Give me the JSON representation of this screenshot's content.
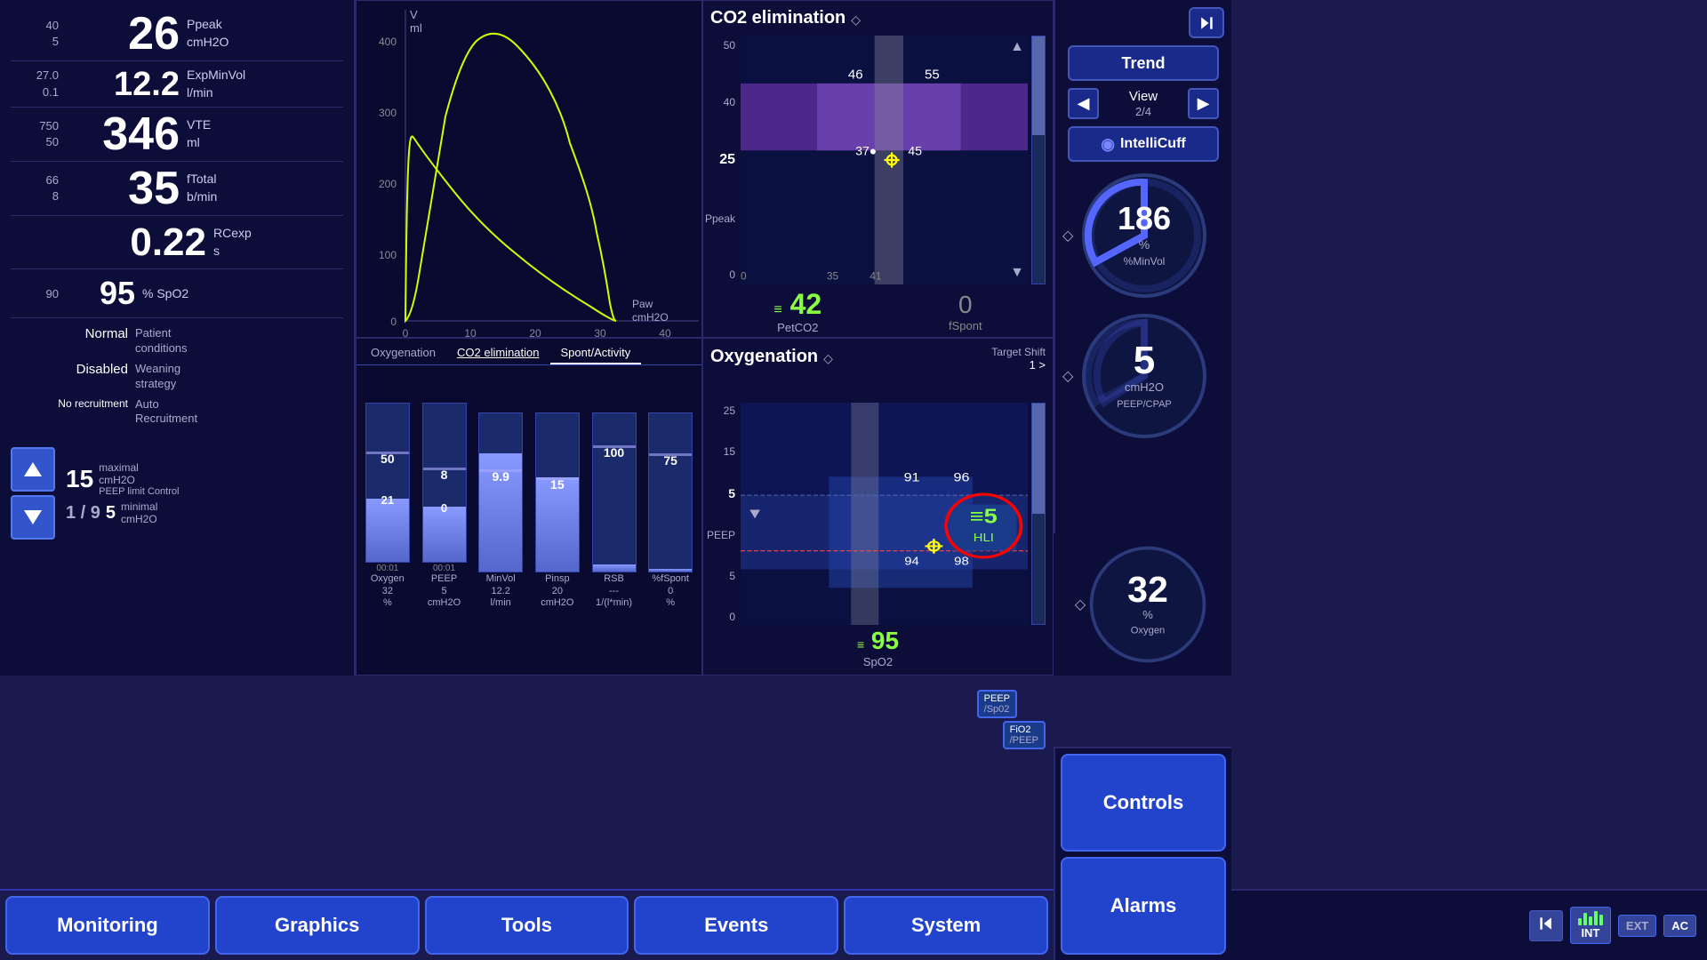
{
  "vitals": {
    "ppeak": {
      "value": "26",
      "unit": "cmH2O",
      "label": "Ppeak",
      "limit_high": "40",
      "limit_low": "5"
    },
    "exp_min_vol": {
      "value": "12.2",
      "unit": "l/min",
      "label": "ExpMinVol",
      "limit_high": "27.0",
      "limit_low": "0.1"
    },
    "vte": {
      "value": "346",
      "unit": "ml",
      "label": "VTE",
      "limit_high": "750",
      "limit_low": "50"
    },
    "ftotal": {
      "value": "35",
      "unit": "b/min",
      "label": "fTotal",
      "limit_high": "66",
      "limit_low": "8"
    },
    "rcexp": {
      "value": "0.22",
      "unit": "s",
      "label": "RCexp",
      "limit_high": "",
      "limit_low": ""
    },
    "spo2": {
      "value": "95",
      "unit": "% SpO2",
      "limit_high": "90",
      "limit_low": ""
    }
  },
  "conditions": {
    "patient": {
      "value": "Normal",
      "label1": "Patient",
      "label2": "conditions"
    },
    "weaning": {
      "value": "Disabled",
      "label1": "Weaning",
      "label2": "strategy"
    },
    "recruitment": {
      "value": "No recruitment",
      "label1": "Auto",
      "label2": "Recruitment"
    }
  },
  "peep": {
    "page": "1 / 9",
    "maximal": {
      "value": "15",
      "unit": "maximal cmH2O",
      "label": "PEEP limit Control"
    },
    "minimal": {
      "value": "5",
      "unit": "minimal cmH2O"
    }
  },
  "chart_loop": {
    "x_label": "Paw cmH2O",
    "y_label": "V ml",
    "x_max": "40",
    "y_max": "400"
  },
  "monitor_tabs": {
    "tabs": [
      "Oxygenation",
      "CO2 elimination",
      "Spont/Activity"
    ],
    "active": "Spont/Activity",
    "bars": [
      {
        "label": "Oxygen",
        "value": "32",
        "unit": "%",
        "target": "50",
        "time": "00:01"
      },
      {
        "label": "PEEP",
        "value": "5",
        "unit": "cmH2O",
        "target": "8",
        "time": "00:01"
      },
      {
        "label": "MinVol",
        "value": "12.2",
        "unit": "l/min",
        "target": "9.9",
        "time": ""
      },
      {
        "label": "Pinsp",
        "value": "20",
        "unit": "cmH2O",
        "target": "15",
        "time": ""
      },
      {
        "label": "RSB",
        "value": "---",
        "unit": "1/(l*min)",
        "target": "100",
        "time": ""
      },
      {
        "label": "%fSpont",
        "value": "0",
        "unit": "%",
        "target": "75",
        "time": ""
      }
    ]
  },
  "co2_panel": {
    "title": "CO2 elimination",
    "ppeak_label": "Ppeak",
    "value_left": "25",
    "value_petco2": "42",
    "petco2_label": "PetCO2",
    "fspont_value": "0",
    "fspont_label": "fSpont",
    "chart_vals": {
      "top1": "46",
      "top2": "55",
      "mid1": "37",
      "mid2": "45",
      "bot": "0",
      "bot2": "35",
      "bot3": "41"
    }
  },
  "oxy_panel": {
    "title": "Oxygenation",
    "target_shift": "Target Shift",
    "target_val": "1 >",
    "peep_sp02_label": "PEEP / SpO2",
    "fio2_peep_label": "FiO2 / PEEP",
    "value_left": "25",
    "value_peep": "5",
    "peep_label": "PEEP",
    "value_spo2": "95",
    "spo2_label": "SpO2",
    "hli_value": "5",
    "hli_label": "HLI",
    "chart_vals": {
      "v1": "91",
      "v2": "96",
      "v3": "94",
      "v4": "98"
    }
  },
  "far_right": {
    "trend_label": "Trend",
    "view_label": "View",
    "view_page": "2/4",
    "intelli_label": "IntelliCuff",
    "dial1": {
      "value": "186",
      "unit": "%\n%MinVol"
    },
    "dial2": {
      "value": "5",
      "unit": "cmH2O\nPEEP/CPAP"
    },
    "dial3": {
      "value": "32",
      "unit": "%\nOxygen"
    }
  },
  "bottom_nav": {
    "tabs": [
      "Monitoring",
      "Graphics",
      "Tools",
      "Events",
      "System"
    ]
  },
  "right_buttons": {
    "controls": "Controls",
    "alarms": "Alarms"
  },
  "status_bar": {
    "ext": "EXT",
    "int": "INT",
    "ac": "AC"
  }
}
